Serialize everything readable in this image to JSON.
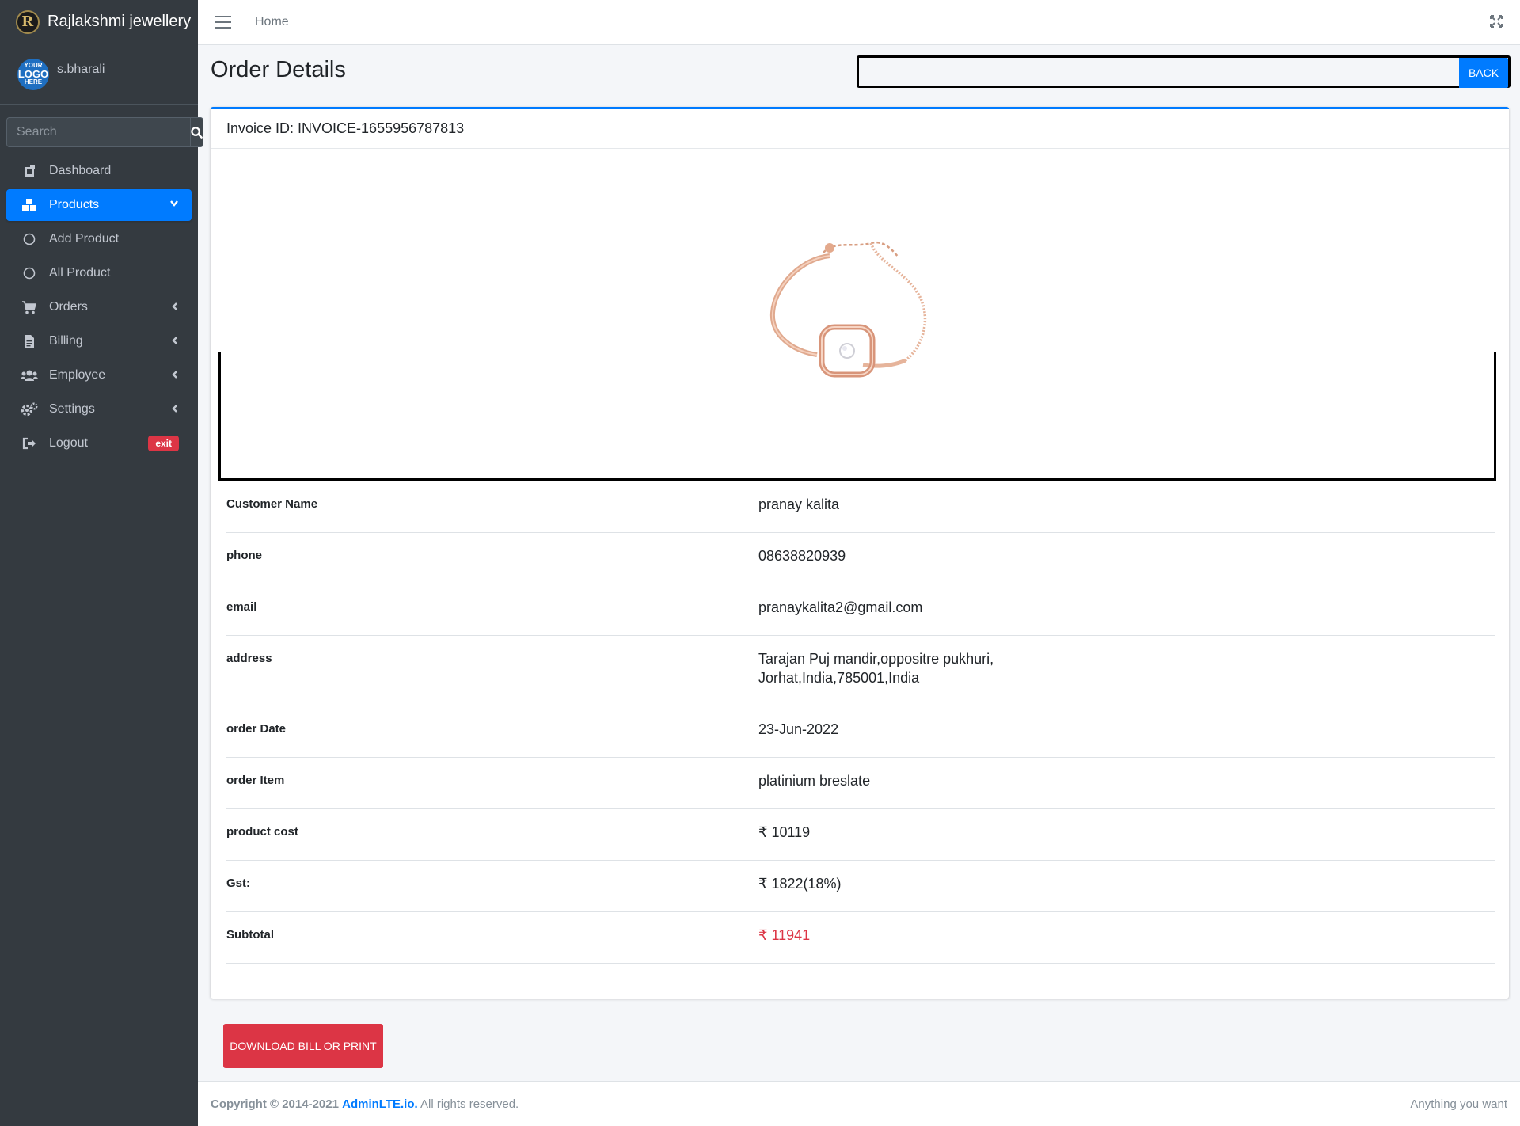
{
  "brand": {
    "logo_letter": "R",
    "name": "Rajlakshmi jewellery"
  },
  "user": {
    "avatar_top": "YOUR",
    "avatar_mid": "LOGO",
    "avatar_bottom": "HERE",
    "name": "s.bharali"
  },
  "search": {
    "placeholder": "Search"
  },
  "nav": {
    "dashboard": "Dashboard",
    "products": "Products",
    "add_product": "Add Product",
    "all_product": "All Product",
    "orders": "Orders",
    "billing": "Billing",
    "employee": "Employee",
    "settings": "Settings",
    "logout": "Logout",
    "logout_badge": "exit"
  },
  "header": {
    "home": "Home"
  },
  "page": {
    "title": "Order Details",
    "back_label": "BACK"
  },
  "invoice": {
    "label": "Invoice ID: INVOICE-1655956787813"
  },
  "details": {
    "customer_name": {
      "label": "Customer Name",
      "value": "pranay kalita"
    },
    "phone": {
      "label": "phone",
      "value": "08638820939"
    },
    "email": {
      "label": "email",
      "value": "pranaykalita2@gmail.com"
    },
    "address": {
      "label": "address",
      "line1": "Tarajan Puj mandir,oppositre pukhuri,",
      "line2": "Jorhat,India,785001,India"
    },
    "order_date": {
      "label": "order Date",
      "value": "23-Jun-2022"
    },
    "order_item": {
      "label": "order Item",
      "value": "platinium breslate"
    },
    "product_cost": {
      "label": "product cost",
      "value": "₹ 10119"
    },
    "gst": {
      "label": "Gst:",
      "value": "₹ 1822(18%)"
    },
    "subtotal": {
      "label": "Subtotal",
      "value": "₹ 11941"
    }
  },
  "actions": {
    "download_label": "DOWNLOAD BILL OR PRINT"
  },
  "footer": {
    "copyright": "Copyright © 2014-2021",
    "link": "AdminLTE.io.",
    "rights": "All rights reserved.",
    "tagline": "Anything you want"
  },
  "colors": {
    "primary": "#007bff",
    "danger": "#dc3545",
    "sidebar": "#343a40",
    "product_metal": "#e8b49a"
  }
}
